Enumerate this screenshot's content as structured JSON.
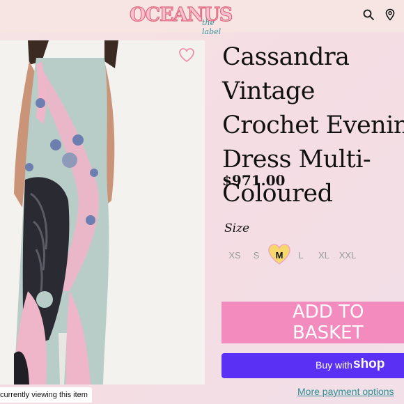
{
  "brand": {
    "name": "OCEANUS",
    "tagline": "the label"
  },
  "header": {
    "icons": [
      "search-icon",
      "location-pin-icon"
    ]
  },
  "product": {
    "title": "Cassandra Vintage\nCrochet Evening\nDress Multi-\nColoured",
    "price": "$971.00",
    "size_label": "Size",
    "sizes": [
      "XS",
      "S",
      "M",
      "L",
      "XL",
      "XXL"
    ],
    "selected_size": "M",
    "wishlist_icon": "heart-outline-icon"
  },
  "actions": {
    "add_to_basket": "ADD TO BASKET",
    "buy_with": "Buy with",
    "shop_brand": "shop",
    "more_payment": "More payment options"
  },
  "notice": {
    "viewing": "currently viewing this item"
  },
  "colors": {
    "accent_pink": "#f38bbf",
    "shop_purple": "#5a31f4",
    "link_teal": "#2f8f93",
    "selected_size_heart": "#f6d86b"
  }
}
